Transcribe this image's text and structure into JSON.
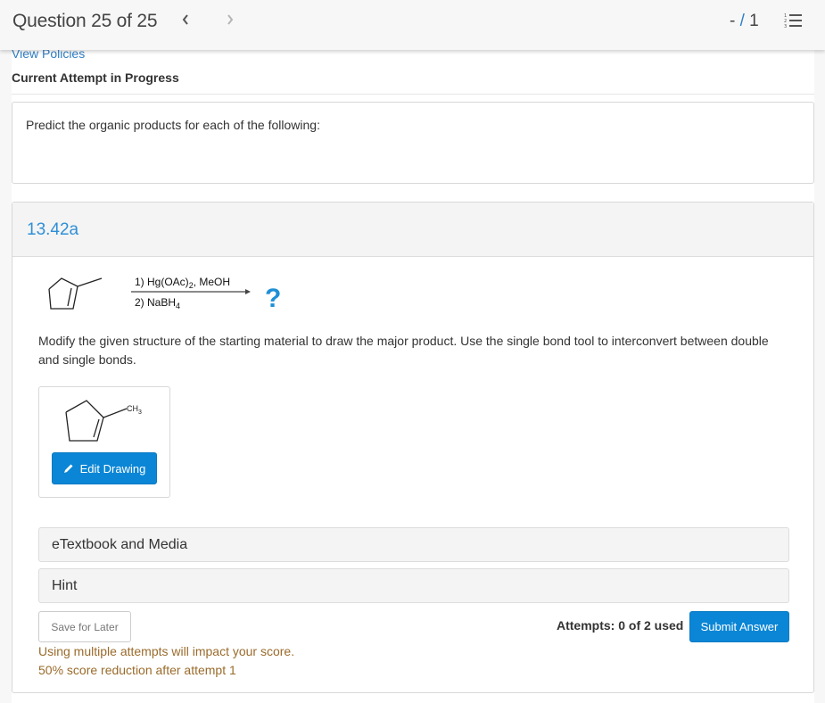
{
  "topbar": {
    "question_label": "Question 25 of 25",
    "prev_icon": "chevron-left-icon",
    "next_icon": "chevron-right-icon",
    "score_dash": "-",
    "score_separator": " / ",
    "score_total": "1",
    "list_icon": "numbered-list-icon"
  },
  "header": {
    "view_policies": "View Policies",
    "attempt_status": "Current Attempt in Progress"
  },
  "prompt": {
    "text": "Predict the organic products for each of the following:"
  },
  "question": {
    "id": "13.42a",
    "reaction": {
      "reagent_1_prefix": "1) Hg(OAc)",
      "reagent_1_sub": "2",
      "reagent_1_suffix": ", MeOH",
      "reagent_2_prefix": "2) NaBH",
      "reagent_2_sub": "4",
      "product_placeholder": "?",
      "accent_color": "#1e8fd6"
    },
    "instructions": "Modify the given structure of the starting material to draw the major product. Use the single bond tool to interconvert between double and single bonds.",
    "drawing": {
      "label_main": "CH",
      "label_sub": "3",
      "edit_button": "Edit Drawing",
      "edit_icon": "pencil-icon"
    },
    "accordions": [
      {
        "label": "eTextbook and Media"
      },
      {
        "label": "Hint"
      }
    ],
    "save_button": "Save for Later",
    "attempts": "Attempts: 0 of 2 used",
    "submit_button": "Submit Answer",
    "warning_line1": "Using multiple attempts will impact your score.",
    "warning_line2": "50% score reduction after attempt 1"
  },
  "colors": {
    "primary": "#0b86d6",
    "link": "#2f7fc6",
    "warning_text": "#9a6b2b"
  }
}
